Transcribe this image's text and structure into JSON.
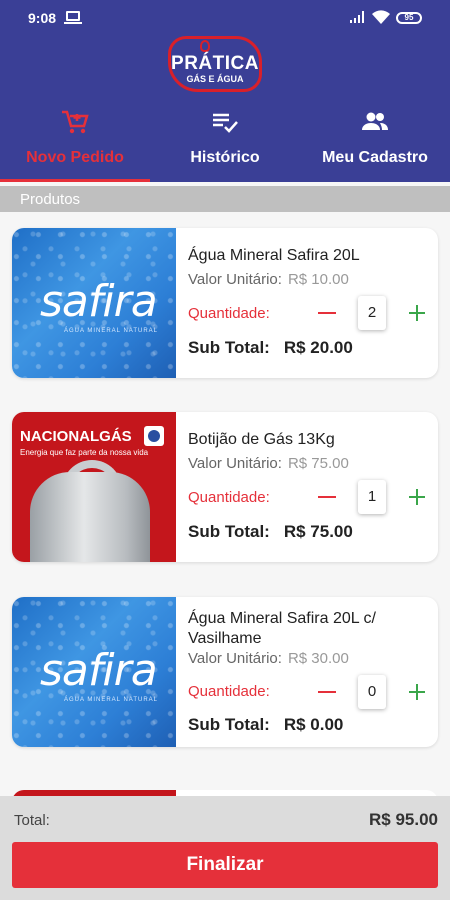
{
  "status_bar": {
    "time": "9:08",
    "battery": "95"
  },
  "brand": {
    "name": "PRÁTICA",
    "tagline": "GÁS E ÁGUA"
  },
  "tabs": [
    {
      "label": "Novo Pedido",
      "icon": "cart-icon",
      "active": true
    },
    {
      "label": "Histórico",
      "icon": "list-check-icon",
      "active": false
    },
    {
      "label": "Meu Cadastro",
      "icon": "people-icon",
      "active": false
    }
  ],
  "section_title": "Produtos",
  "labels": {
    "unit_price": "Valor Unitário:",
    "quantity": "Quantidade:",
    "subtotal": "Sub Total:"
  },
  "products": [
    {
      "name": "Água Mineral Safira 20L",
      "unit_price": "R$ 10.00",
      "quantity": "2",
      "subtotal": "R$ 20.00",
      "image": "safira",
      "image_text": "safira",
      "image_sub": "ÁGUA MINERAL NATURAL"
    },
    {
      "name": "Botijão de Gás 13Kg",
      "unit_price": "R$ 75.00",
      "quantity": "1",
      "subtotal": "R$ 75.00",
      "image": "nacional",
      "image_text": "NACIONALGÁS",
      "image_sub": "Energia que faz parte da nossa vida"
    },
    {
      "name": "Água Mineral Safira 20L c/ Vasilhame",
      "unit_price": "R$ 30.00",
      "quantity": "0",
      "subtotal": "R$ 0.00",
      "image": "safira",
      "image_text": "safira",
      "image_sub": "ÁGUA MINERAL NATURAL"
    }
  ],
  "footer": {
    "total_label": "Total:",
    "total_value": "R$ 95.00",
    "finalize_label": "Finalizar"
  },
  "colors": {
    "header": "#3a3f96",
    "accent": "#e5303a",
    "plus": "#3aa64a"
  }
}
